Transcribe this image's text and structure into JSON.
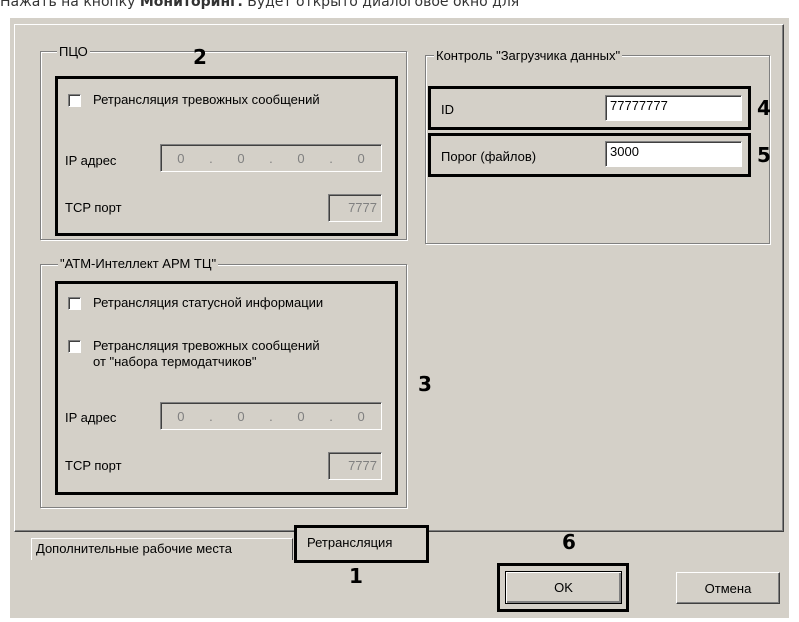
{
  "doc_text": {
    "before": "Нажать на кнопку ",
    "bold": "Мониторинг.",
    "after": " Будет открыто диалоговое окно для"
  },
  "pco_group": {
    "title": "ПЦО",
    "relay_alarm_label": "Ретрансляция тревожных сообщений",
    "ip_label": "IP адрес",
    "ip_octets": [
      "0",
      "0",
      "0",
      "0"
    ],
    "tcp_label": "TCP порт",
    "tcp_value": "7777"
  },
  "atm_group": {
    "title": "\"АТМ-Интеллект АРМ ТЦ\"",
    "relay_status_label": "Ретрансляция статусной информации",
    "relay_alarm_line1": "Ретрансляция тревожных сообщений",
    "relay_alarm_line2": "от \"набора термодатчиков\"",
    "ip_label": "IP адрес",
    "ip_octets": [
      "0",
      "0",
      "0",
      "0"
    ],
    "tcp_label": "TCP порт",
    "tcp_value": "7777"
  },
  "loader_group": {
    "title": "Контроль \"Загрузчика данных\"",
    "id_label": "ID",
    "id_value": "77777777",
    "threshold_label": "Порог (файлов)",
    "threshold_value": "3000"
  },
  "callouts": {
    "n1": "1",
    "n2": "2",
    "n3": "3",
    "n4": "4",
    "n5": "5",
    "n6": "6"
  },
  "tabs": {
    "additional": "Дополнительные рабочие места",
    "relay": "Ретрансляция"
  },
  "buttons": {
    "ok": "OK",
    "cancel": "Отмена"
  }
}
